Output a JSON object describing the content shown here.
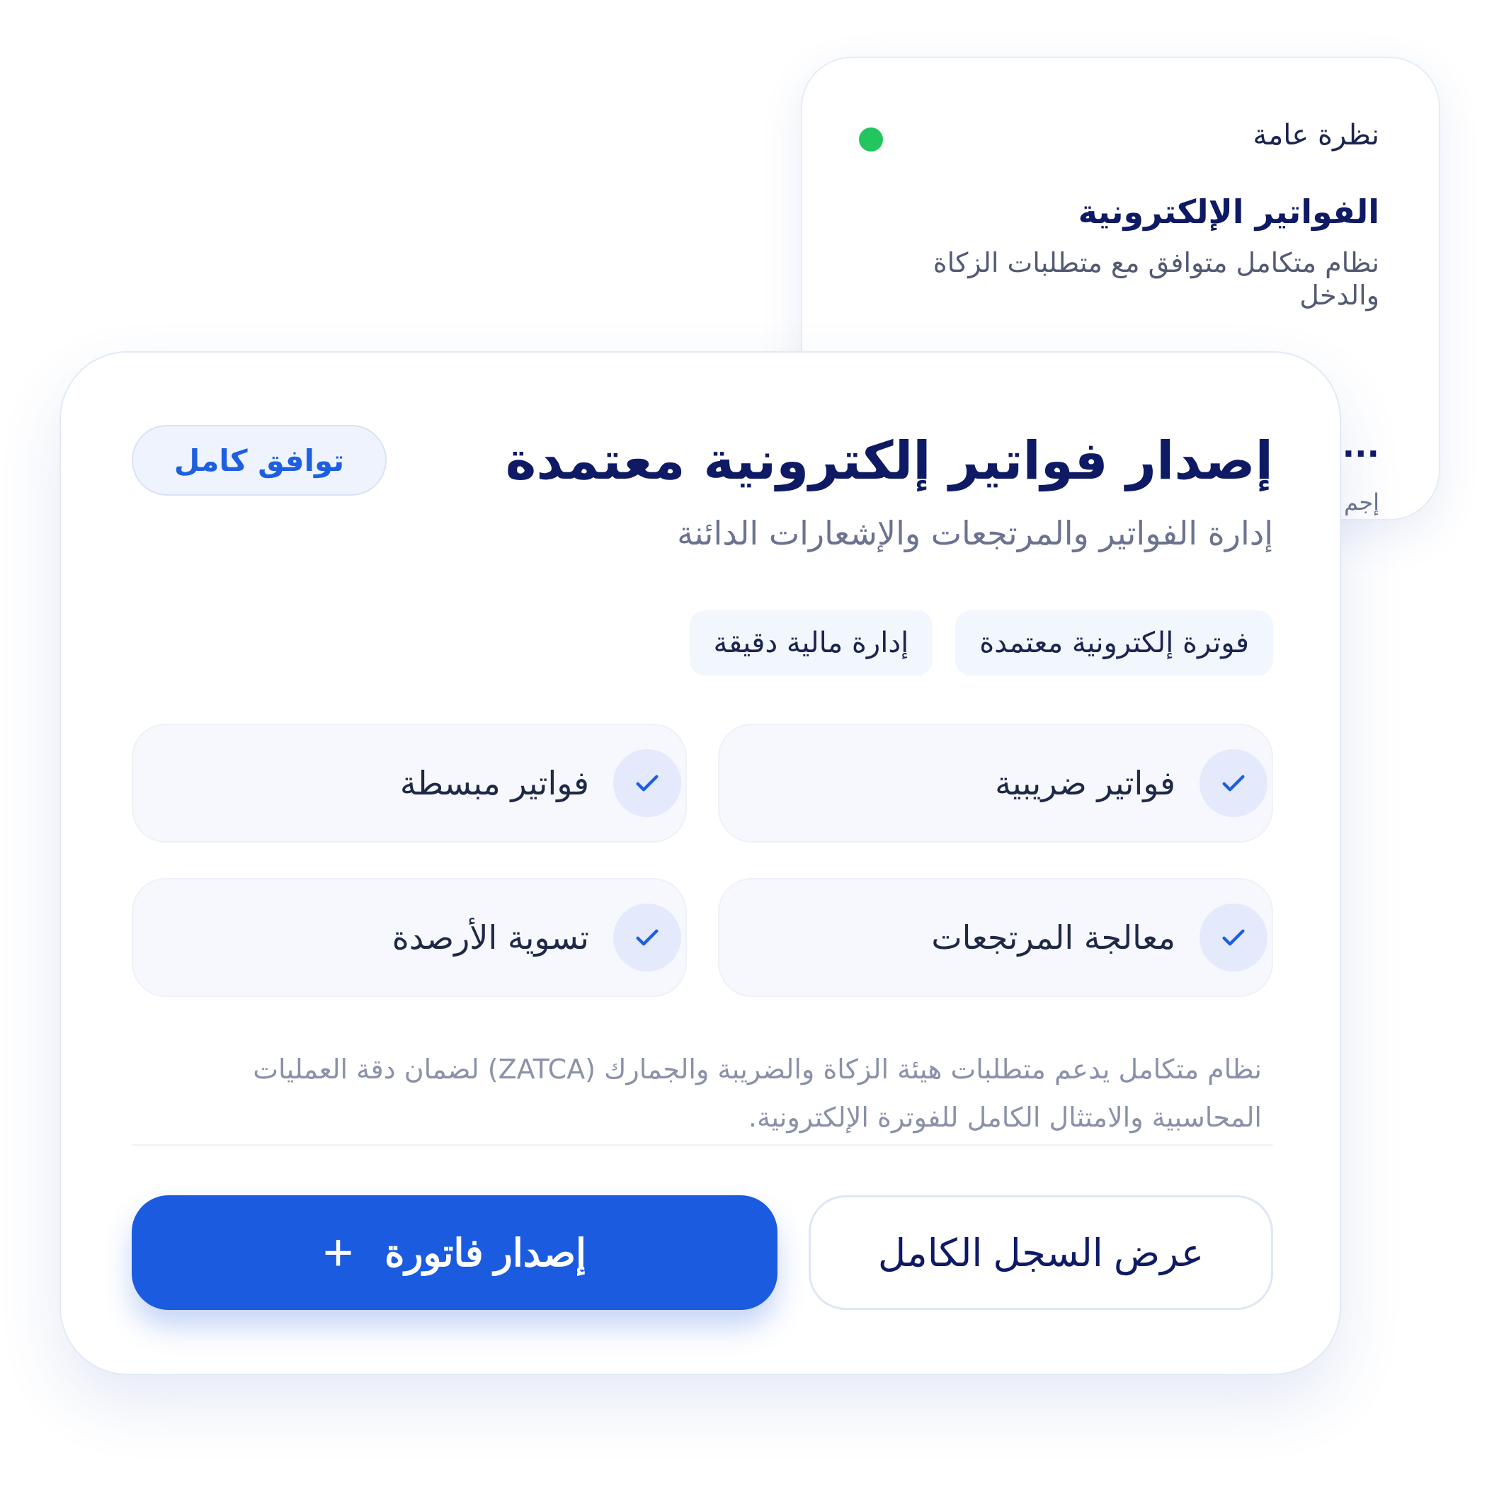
{
  "back_card": {
    "overview_label": "نظرة عامة",
    "title": "الفواتير الإلكترونية",
    "description": "نظام متكامل متوافق مع متطلبات الزكاة والدخل",
    "partial_value": "...",
    "partial_label": "إجم"
  },
  "main_card": {
    "title": "إصدار فواتير إلكترونية معتمدة",
    "subtitle": "إدارة الفواتير والمرتجعات والإشعارات الدائنة",
    "badge": "توافق كامل",
    "tags": [
      "فوترة إلكترونية معتمدة",
      "إدارة مالية دقيقة"
    ],
    "features": [
      {
        "label": "فواتير ضريبية"
      },
      {
        "label": "فواتير مبسطة"
      },
      {
        "label": "معالجة المرتجعات"
      },
      {
        "label": "تسوية الأرصدة"
      }
    ],
    "description": "نظام متكامل يدعم متطلبات هيئة الزكاة والضريبة والجمارك (ZATCA) لضمان دقة العمليات المحاسبية والامتثال الكامل للفوترة الإلكترونية.",
    "primary_button": "إصدار فاتورة",
    "secondary_button": "عرض السجل الكامل"
  },
  "colors": {
    "primary": "#1a5be0",
    "title": "#0e1a64",
    "status_dot": "#22c55e"
  },
  "icons": {
    "status": "status-dot-icon",
    "check": "check-icon",
    "add": "plus-icon"
  }
}
